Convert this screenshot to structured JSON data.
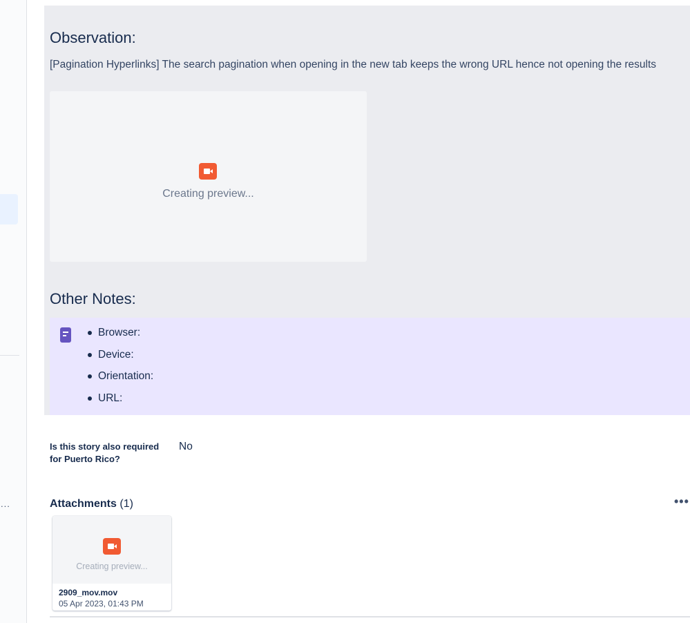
{
  "observation": {
    "title": "Observation:",
    "text": "[Pagination Hyperlinks] The search pagination when opening in the new tab keeps the wrong URL hence not opening the results",
    "preview_text": "Creating preview..."
  },
  "other_notes": {
    "title": "Other Notes:",
    "items": [
      "Browser:",
      "Device:",
      "Orientation:",
      "URL:"
    ]
  },
  "field": {
    "label": "Is this story also required for Puerto Rico?",
    "value": "No"
  },
  "attachments": {
    "title": "Attachments",
    "count": "(1)",
    "more_label": "•••",
    "items": [
      {
        "preview_text": "Creating preview...",
        "name": "2909_mov.mov",
        "date": "05 Apr 2023, 01:43 PM"
      }
    ]
  },
  "sidebar": {
    "more_label": "..."
  },
  "colors": {
    "video_icon": "#f15a32",
    "note_panel": "#eae6ff",
    "note_icon": "#6554c0",
    "panel_bg": "#ebecf0"
  }
}
